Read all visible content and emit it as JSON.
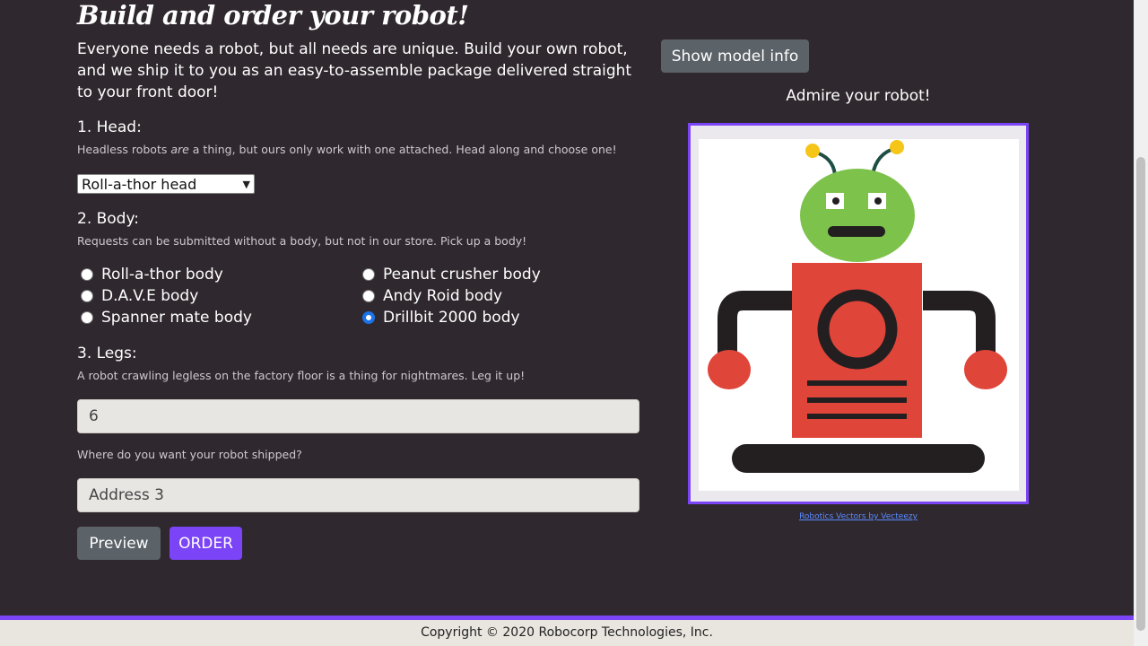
{
  "page": {
    "title": "Build and order your robot!",
    "intro": "Everyone needs a robot, but all needs are unique. Build your own robot, and we ship it to you as an easy-to-assemble package delivered straight to your front door!"
  },
  "head": {
    "heading": "1. Head:",
    "desc_before": "Headless robots ",
    "desc_em": "are",
    "desc_after": " a thing, but ours only work with one attached. Head along and choose one!",
    "selected": "Roll-a-thor head"
  },
  "body": {
    "heading": "2. Body:",
    "desc": "Requests can be submitted without a body, but not in our store. Pick up a body!",
    "options": [
      {
        "label": "Roll-a-thor body",
        "checked": false
      },
      {
        "label": "Peanut crusher body",
        "checked": false
      },
      {
        "label": "D.A.V.E body",
        "checked": false
      },
      {
        "label": "Andy Roid body",
        "checked": false
      },
      {
        "label": "Spanner mate body",
        "checked": false
      },
      {
        "label": "Drillbit 2000 body",
        "checked": true
      }
    ]
  },
  "legs": {
    "heading": "3. Legs:",
    "desc": "A robot crawling legless on the factory floor is a thing for nightmares. Leg it up!",
    "value": "6"
  },
  "address": {
    "label": "Where do you want your robot shipped?",
    "value": "Address 3"
  },
  "buttons": {
    "preview": "Preview",
    "order": "ORDER",
    "model_info": "Show model info"
  },
  "preview": {
    "heading": "Admire your robot!",
    "credit": "Robotics Vectors by Vecteezy"
  },
  "footer": {
    "copyright": "Copyright © 2020 Robocorp Technologies, Inc."
  },
  "colors": {
    "background": "#2f282e",
    "accent": "#7b44f6",
    "button_gray": "#5b6268",
    "robot_head": "#7dc24b",
    "robot_body": "#e0453a",
    "robot_dark": "#231f20",
    "antenna_tip": "#f5c518"
  },
  "icons": {
    "select_arrow": "chevron-down-icon",
    "radio": "radio-button-icon",
    "robot": "robot-illustration"
  }
}
